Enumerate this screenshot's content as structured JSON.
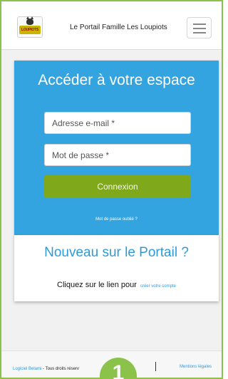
{
  "header": {
    "logo_text": "LOUPIOTS",
    "site_title": "Le Portail Famille Les Loupiots",
    "menu_icon": "hamburger-menu-icon"
  },
  "login": {
    "heading": "Accéder à votre espace",
    "email_placeholder": "Adresse e-mail *",
    "password_placeholder": "Mot de passe *",
    "connect_label": "Connexion",
    "forgot_label": "Mot de passe oublié ?"
  },
  "signup": {
    "heading": "Nouveau sur le Portail ?",
    "text": "Cliquez sur le lien pour",
    "link_label": "créer votre compte"
  },
  "footer": {
    "brand": "Logiciel Belami",
    "rights": " - Tous droits réserv",
    "legal_label": "Mentions légales"
  },
  "badge": {
    "label": "1"
  },
  "colors": {
    "accent_green": "#8bc34a",
    "login_blue": "#33a4e0",
    "button_green": "#7fa81a",
    "link_blue": "#2e9bd8"
  }
}
